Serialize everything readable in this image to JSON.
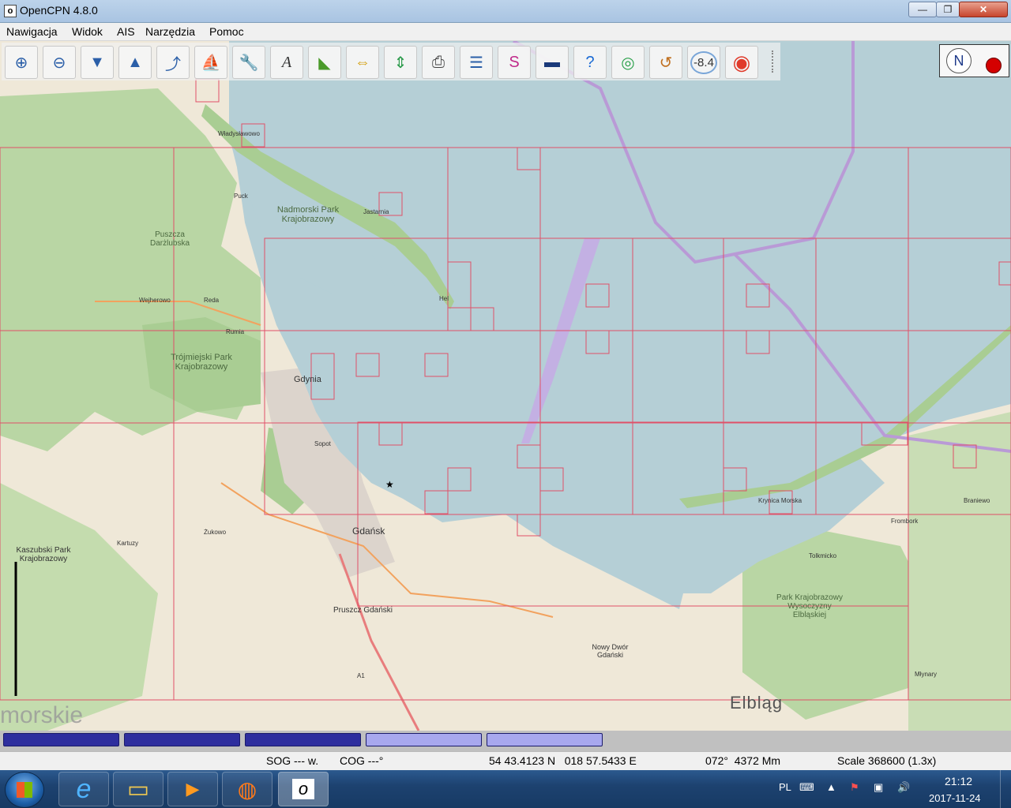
{
  "window": {
    "title": "OpenCPN 4.8.0",
    "app_icon": "o",
    "minimize": "—",
    "maximize": "❐",
    "close": "✕"
  },
  "menu": [
    "Nawigacja",
    "Widok",
    "AIS",
    "Narzędzia",
    "Pomoc"
  ],
  "toolbar": {
    "buttons": [
      {
        "name": "zoom-in-icon",
        "glyph": "⊕"
      },
      {
        "name": "zoom-out-icon",
        "glyph": "⊖"
      },
      {
        "name": "scale-down-icon",
        "glyph": "▼"
      },
      {
        "name": "scale-up-icon",
        "glyph": "▲"
      },
      {
        "name": "route-icon",
        "glyph": "⤴"
      },
      {
        "name": "follow-ship-icon",
        "glyph": "⛵"
      },
      {
        "name": "settings-wrench-icon",
        "glyph": "🔧"
      },
      {
        "name": "text-toggle-icon",
        "glyph": "A"
      },
      {
        "name": "enc-light-icon",
        "glyph": "◣"
      },
      {
        "name": "current-icon",
        "glyph": "⇔"
      },
      {
        "name": "tide-icon",
        "glyph": "⇕"
      },
      {
        "name": "print-icon",
        "glyph": "⎙"
      },
      {
        "name": "route-manager-icon",
        "glyph": "☰"
      },
      {
        "name": "track-icon",
        "glyph": "S"
      },
      {
        "name": "color-scheme-icon",
        "glyph": "▬"
      },
      {
        "name": "help-icon",
        "glyph": "?"
      },
      {
        "name": "ais-icon",
        "glyph": "◎"
      },
      {
        "name": "mob-line-icon",
        "glyph": "↺"
      },
      {
        "name": "tide-height-icon",
        "glyph": "-8.4"
      },
      {
        "name": "man-overboard-icon",
        "glyph": "◉"
      }
    ]
  },
  "map": {
    "labels": [
      {
        "text": "Nadmorski Park Krajobrazowy"
      },
      {
        "text": "Trójmiejski Park Krajobrazowy"
      },
      {
        "text": "Puszcza Darżlubska"
      },
      {
        "text": "Kaszubski Park Krajobrazowy"
      },
      {
        "text": "Gdynia"
      },
      {
        "text": "Gdańsk"
      },
      {
        "text": "Pruszcz Gdański"
      },
      {
        "text": "Nowy Dwór Gdański"
      },
      {
        "text": "Krynica Morska"
      },
      {
        "text": "Park Krajobrazowy Wysoczyzny Elbląskiej"
      },
      {
        "text": "Elbląg"
      },
      {
        "text": "Władysławowo"
      },
      {
        "text": "Jastarnia"
      },
      {
        "text": "Hel"
      },
      {
        "text": "Wejherowo"
      },
      {
        "text": "Reda"
      },
      {
        "text": "Rumia"
      },
      {
        "text": "Sopot"
      },
      {
        "text": "Żukowo"
      },
      {
        "text": "Kartuzy"
      },
      {
        "text": "Frombork"
      },
      {
        "text": "Tolkmicko"
      },
      {
        "text": "Braniewo"
      },
      {
        "text": "Młynary"
      },
      {
        "text": "Puck"
      },
      {
        "text": "morskie"
      },
      {
        "text": "A1"
      }
    ]
  },
  "compass": {
    "north": "N"
  },
  "chartbar": {
    "quilt_colors": [
      "#2e2e9e",
      "#2e2e9e",
      "#2e2e9e",
      "#a8a8ee",
      "#a8a8ee"
    ]
  },
  "status": {
    "sog": "SOG --- w.",
    "cog": "COG ---°",
    "position": "54 43.4123 N   018 57.5433 E",
    "bearing": "072°  4372 Mm",
    "scale": "Scale 368600 (1.3x)"
  },
  "taskbar": {
    "apps": [
      {
        "name": "internet-explorer-icon",
        "glyph": "e"
      },
      {
        "name": "file-explorer-icon",
        "glyph": "▭"
      },
      {
        "name": "media-player-icon",
        "glyph": "▶"
      },
      {
        "name": "firefox-icon",
        "glyph": "◍"
      },
      {
        "name": "opencpn-task-icon",
        "glyph": "o"
      }
    ],
    "lang": "PL",
    "time": "21:12",
    "date": "2017-11-24"
  }
}
